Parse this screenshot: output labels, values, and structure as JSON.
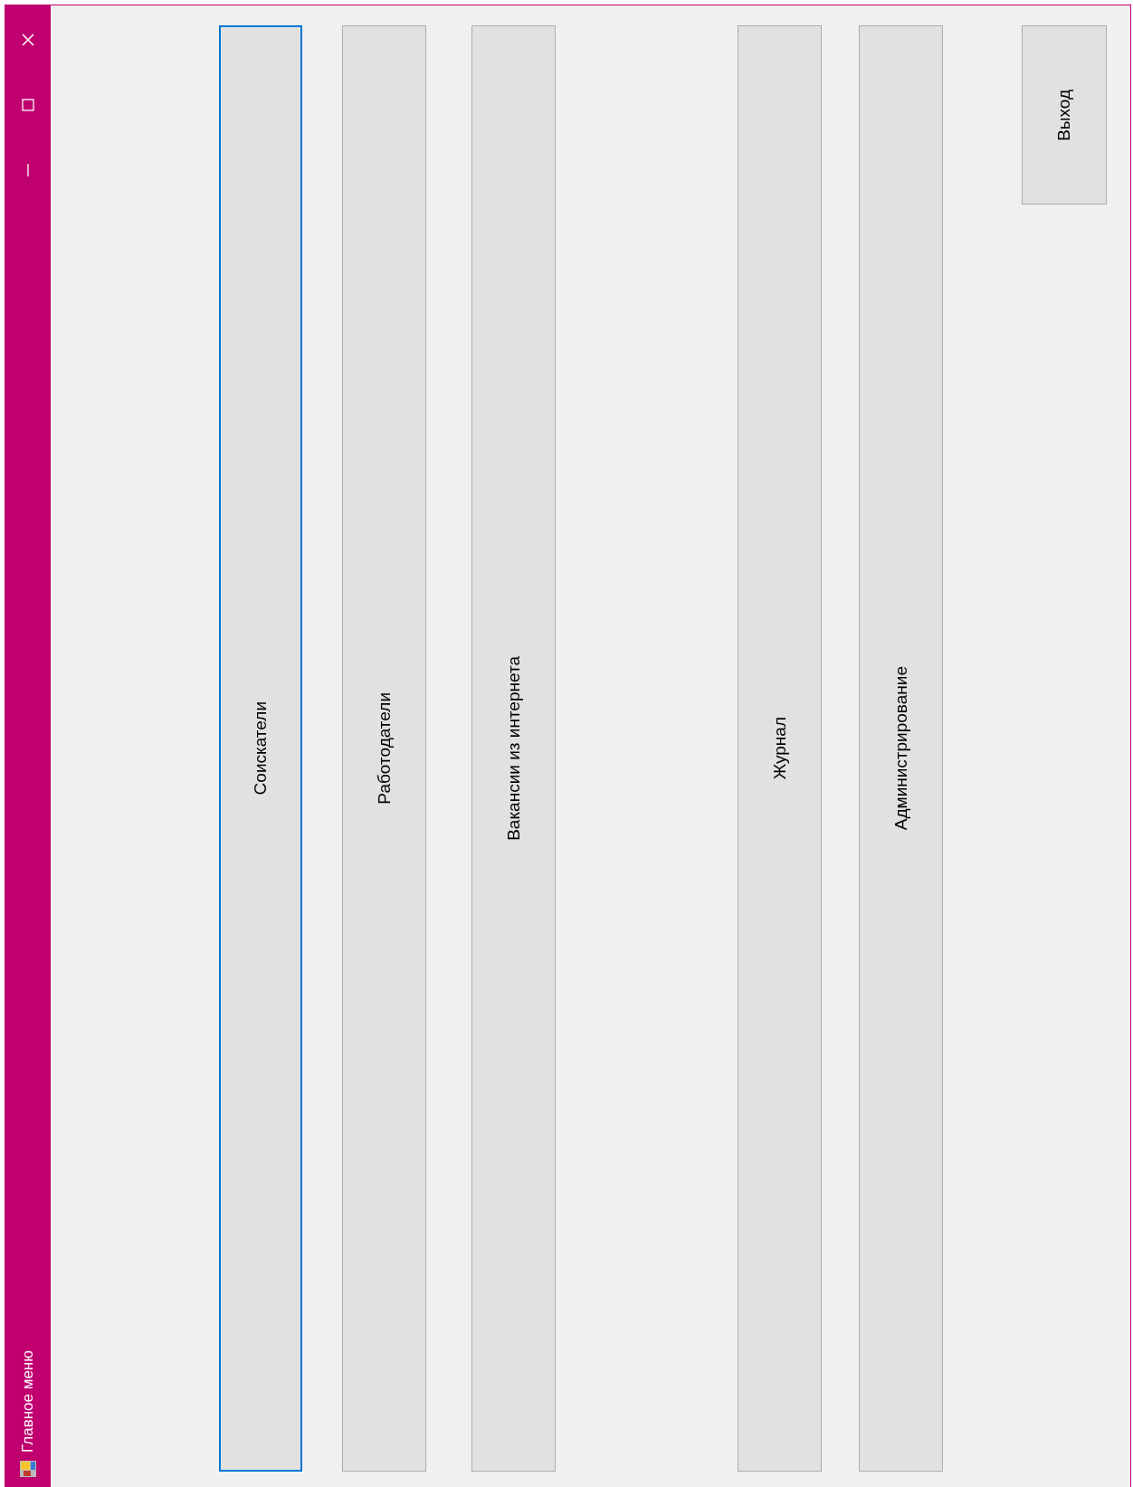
{
  "window": {
    "title": "Главное меню"
  },
  "buttons": [
    {
      "label": "Соискатели",
      "kind": "tall",
      "selected": true
    },
    {
      "label": "Работодатели",
      "kind": "tall",
      "selected": false
    },
    {
      "label": "Вакансии из интернета",
      "kind": "tall",
      "selected": false
    },
    {
      "label": "Журнал",
      "kind": "tall",
      "selected": false
    },
    {
      "label": "Администрирование",
      "kind": "tall",
      "selected": false
    },
    {
      "label": "Выход",
      "kind": "short",
      "selected": false
    }
  ]
}
